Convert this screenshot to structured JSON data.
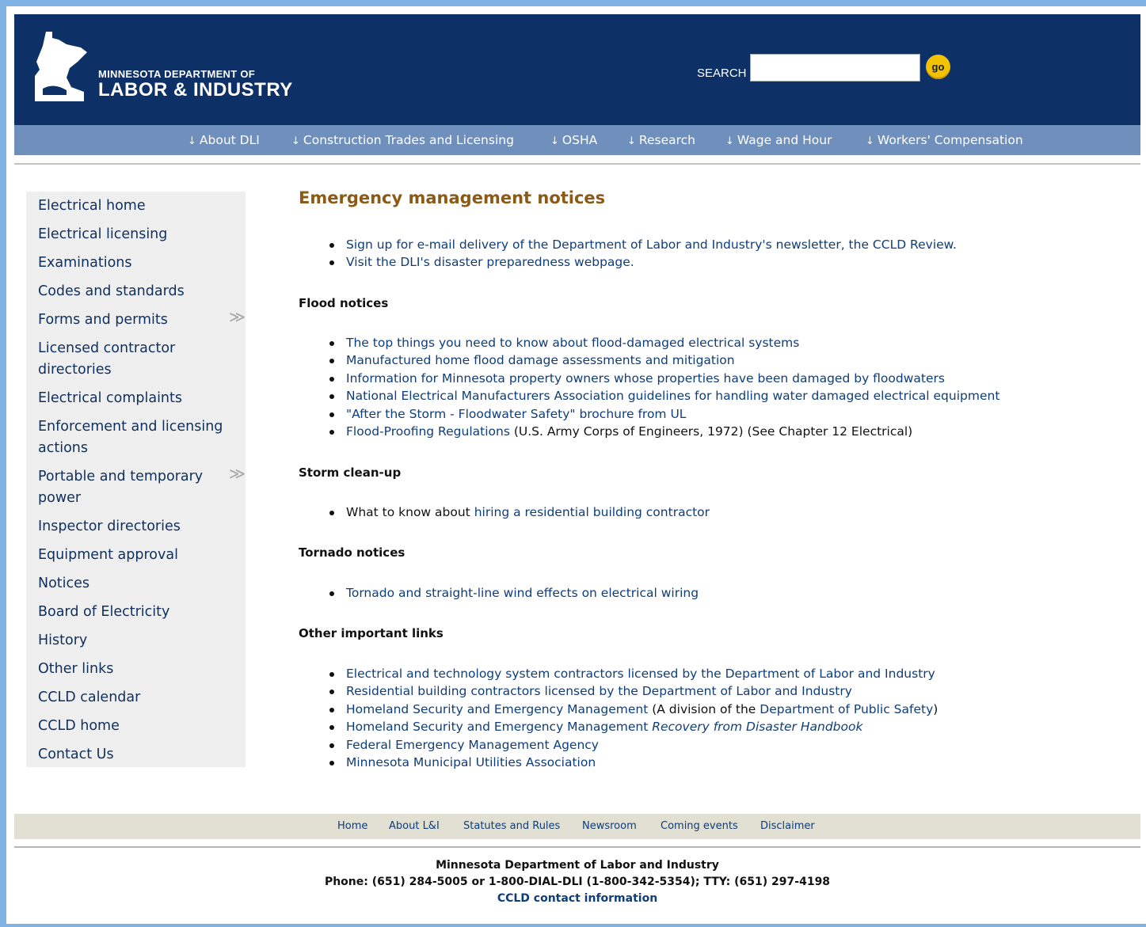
{
  "header": {
    "org_line1": "MINNESOTA DEPARTMENT OF",
    "org_line2": "LABOR & INDUSTRY",
    "search_label": "SEARCH",
    "search_value": "",
    "go_label": "go"
  },
  "nav": {
    "items": [
      "About DLI",
      "Construction Trades and Licensing",
      "OSHA",
      "Research",
      "Wage and Hour",
      "Workers' Compensation"
    ]
  },
  "sidebar": {
    "items": [
      "Electrical home",
      "Electrical licensing",
      "Examinations",
      "Codes and standards",
      "Forms and permits",
      "Licensed contractor directories",
      "Electrical complaints",
      "Enforcement and licensing actions",
      "Portable and temporary power",
      "Inspector directories",
      "Equipment approval",
      "Notices",
      "Board of Electricity",
      "History",
      "Other links",
      "CCLD calendar",
      "CCLD home",
      "Contact Us"
    ]
  },
  "main": {
    "title": "Emergency management notices",
    "intro": [
      "Sign up for e-mail delivery of the Department of Labor and Industry's newsletter, the CCLD Review.",
      "Visit the DLI's disaster preparedness webpage."
    ],
    "flood": {
      "heading": "Flood notices",
      "items": [
        "The top things you need to know about flood-damaged electrical systems",
        "Manufactured home flood damage assessments and mitigation",
        "Information for Minnesota property owners whose properties have been damaged by floodwaters",
        "National Electrical Manufacturers Association guidelines for handling water damaged electrical equipment",
        "\"After the Storm - Floodwater Safety\" brochure from UL"
      ],
      "last_link": "Flood-Proofing Regulations",
      "last_note": " (U.S. Army Corps of Engineers, 1972) (See Chapter 12 Electrical)"
    },
    "storm": {
      "heading": "Storm clean-up",
      "item_prefix": "What to know about ",
      "item_link": "hiring a residential building contractor"
    },
    "tornado": {
      "heading": "Tornado notices",
      "items": [
        "Tornado and straight-line wind effects on electrical wiring"
      ]
    },
    "other": {
      "heading": "Other important links",
      "item1": "Electrical and technology system contractors licensed by the Department of Labor and Industry",
      "item2": "Residential building contractors licensed by the Department of Labor and Industry",
      "item3_link": "Homeland Security and Emergency Management",
      "item3_mid": "  (A division of the ",
      "item3_link2": "Department of Public Safety",
      "item3_end": ")",
      "item4_link": "Homeland Security and Emergency Management ",
      "item4_italic": "Recovery from Disaster Handbook",
      "item5": "Federal Emergency Management Agency",
      "item6": "Minnesota Municipal Utilities Association"
    }
  },
  "footer": {
    "links": [
      "Home",
      "About L&I",
      "Statutes and Rules",
      "Newsroom",
      "Coming events",
      "Disclaimer"
    ],
    "org": "Minnesota Department of Labor and Industry",
    "phone": "Phone:  (651) 284-5005 or 1-800-DIAL-DLI (1-800-342-5354); TTY:  (651) 297-4198",
    "contact": "CCLD contact information"
  },
  "colors": {
    "header_bg": "#0d3066",
    "nav_bg": "#6f8fbd",
    "title": "#8b5a16",
    "link": "#0f3d7a"
  }
}
